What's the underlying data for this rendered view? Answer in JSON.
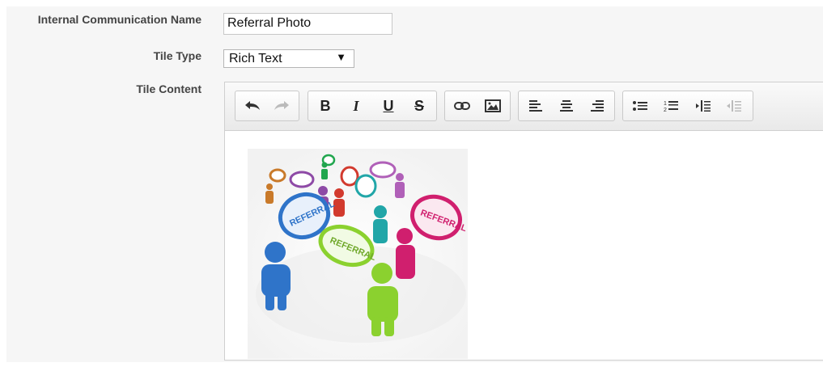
{
  "form": {
    "comm_name_label": "Internal Communication Name",
    "comm_name_value": "Referral Photo",
    "tile_type_label": "Tile Type",
    "tile_type_value": "Rich Text",
    "tile_content_label": "Tile Content"
  },
  "toolbar": {
    "groups": [
      [
        "undo-icon",
        "redo-icon"
      ],
      [
        "bold-icon",
        "italic-icon",
        "underline-icon",
        "strikethrough-icon"
      ],
      [
        "link-icon",
        "image-icon"
      ],
      [
        "align-left-icon",
        "align-center-icon",
        "align-right-icon"
      ],
      [
        "bulleted-list-icon",
        "numbered-list-icon",
        "indent-icon",
        "outdent-icon"
      ]
    ],
    "bold_glyph": "B",
    "italic_glyph": "I",
    "underline_glyph": "U",
    "strike_glyph": "S",
    "dropdown_arrow": "▼"
  },
  "image": {
    "bubbles": [
      "REFERRAL",
      "REFERRAL",
      "REFERRAL"
    ]
  },
  "colors": {
    "panel_bg": "#f6f6f6",
    "person_blue": "#2f74c9",
    "person_green": "#8bd12f",
    "person_pink": "#d01f6e",
    "person_teal": "#21a6a8",
    "person_purple": "#8e4aa6",
    "person_red": "#d23a2e",
    "person_orange": "#c97a2a"
  }
}
